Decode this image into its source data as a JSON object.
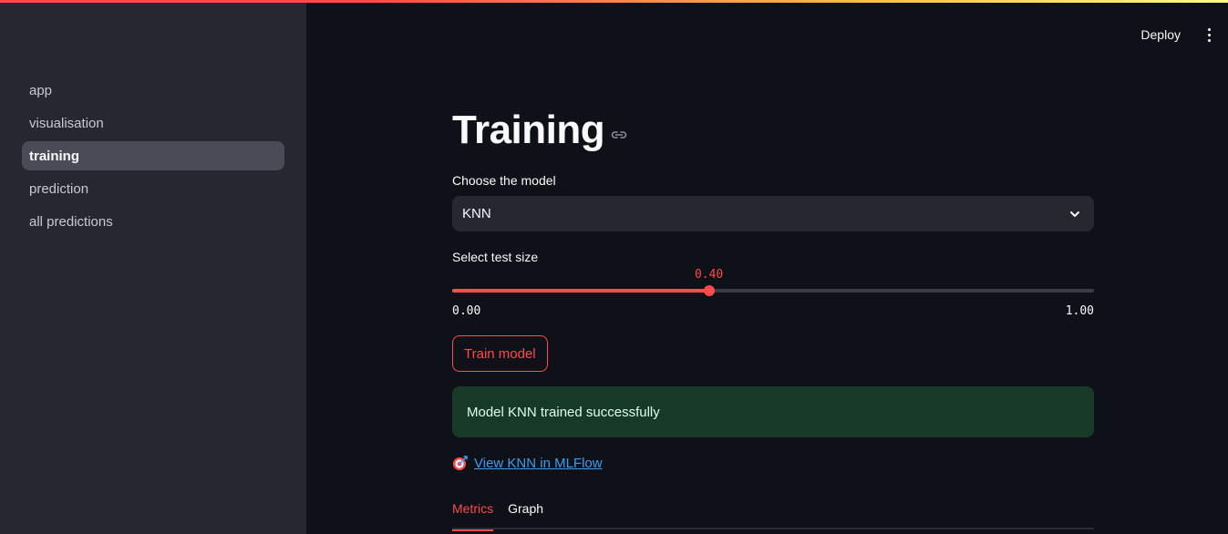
{
  "colors": {
    "accent": "#ff4b4b",
    "sidebar_bg": "#262730",
    "main_bg": "#0e1117",
    "success_bg": "#173928",
    "link": "#3d9df3"
  },
  "header": {
    "deploy_label": "Deploy",
    "menu_icon": "vertical-ellipsis-icon"
  },
  "sidebar": {
    "items": [
      {
        "label": "app",
        "active": false
      },
      {
        "label": "visualisation",
        "active": false
      },
      {
        "label": "training",
        "active": true
      },
      {
        "label": "prediction",
        "active": false
      },
      {
        "label": "all predictions",
        "active": false
      }
    ]
  },
  "main": {
    "title": "Training",
    "title_icon": "link-icon",
    "model_select": {
      "label": "Choose the model",
      "value": "KNN",
      "icon": "chevron-down-icon"
    },
    "test_size_slider": {
      "label": "Select test size",
      "value": 0.4,
      "value_label": "0.40",
      "min": 0,
      "max": 1,
      "min_label": "0.00",
      "max_label": "1.00"
    },
    "train_button_label": "Train model",
    "success_message": "Model KNN trained successfully",
    "mlflow_link": {
      "icon": "target-icon",
      "label": "View KNN in MLFlow"
    },
    "tabs": [
      {
        "label": "Metrics",
        "active": true
      },
      {
        "label": "Graph",
        "active": false
      }
    ]
  }
}
